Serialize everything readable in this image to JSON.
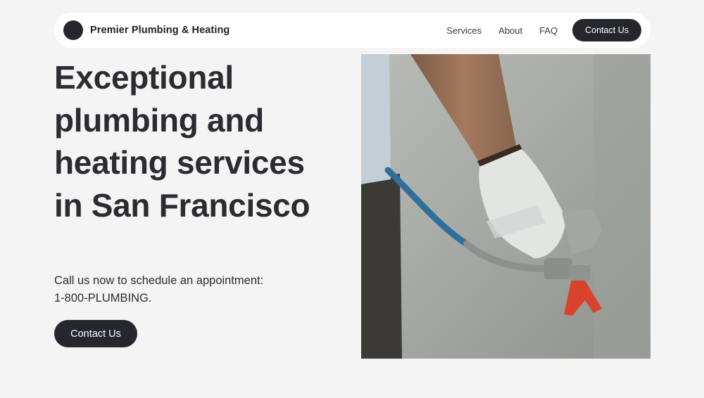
{
  "nav": {
    "brand": "Premier Plumbing & Heating",
    "links": [
      "Services",
      "About",
      "FAQ"
    ],
    "cta": "Contact Us"
  },
  "hero": {
    "headline_lines": [
      "Exceptional",
      "plumbing and",
      "heating services",
      "in San Francisco"
    ],
    "subtext_line1": "Call us now to schedule an appointment:",
    "subtext_line2": "1-800-PLUMBING.",
    "cta": "Contact Us",
    "image_alt": "hand in work glove holding paint sprayer"
  }
}
